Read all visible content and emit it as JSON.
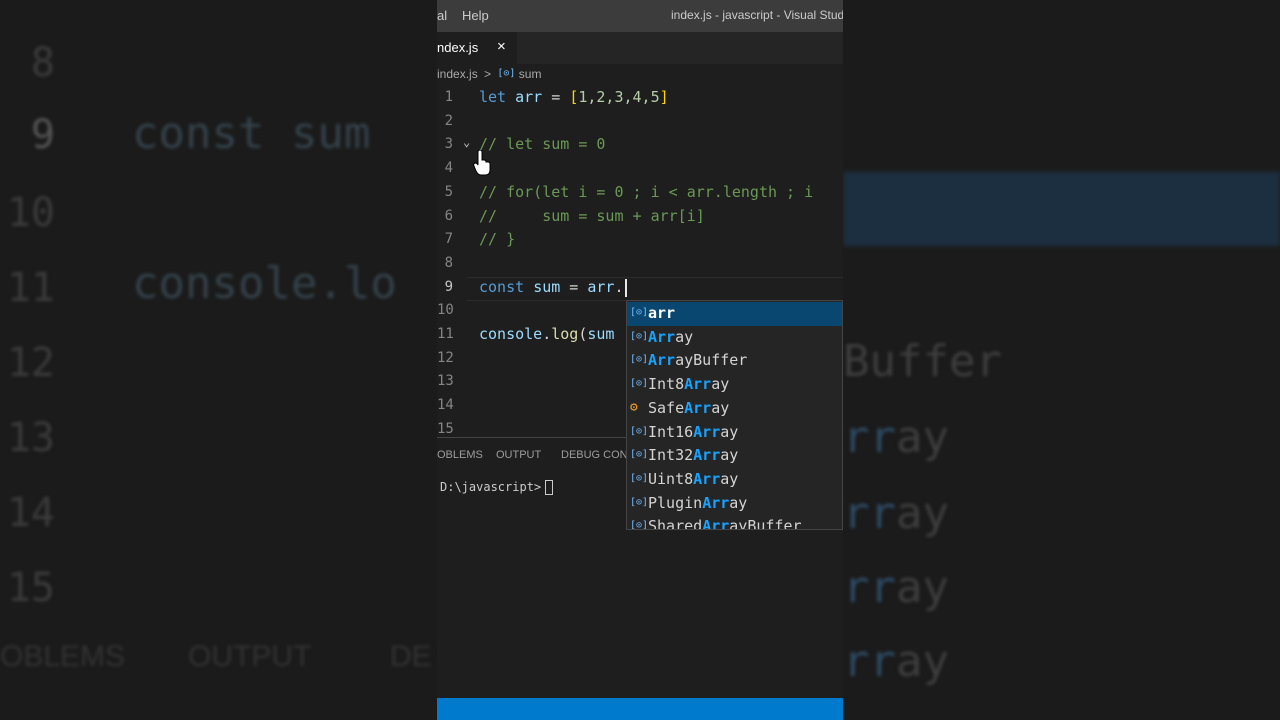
{
  "background": {
    "line_numbers": [
      "8",
      "9",
      "10",
      "11",
      "12",
      "13",
      "14",
      "15"
    ],
    "code": [
      "const sum",
      "console.lo"
    ],
    "suggest_words": [
      {
        "pre": "",
        "match": "",
        "post": "Buffer"
      },
      {
        "pre": "",
        "match": "rr",
        "post": "ay"
      },
      {
        "pre": "",
        "match": "rr",
        "post": "ay"
      },
      {
        "pre": "",
        "match": "rr",
        "post": "ay"
      },
      {
        "pre": "",
        "match": "rr",
        "post": "ay"
      }
    ],
    "panel": [
      "OBLEMS",
      "OUTPUT",
      "DE"
    ]
  },
  "titlebar": {
    "menu": [
      "al",
      "Help"
    ],
    "title": "index.js - javascript - Visual Studi"
  },
  "tab": {
    "name": "ndex.js",
    "close": "×"
  },
  "breadcrumb": {
    "file": "index.js",
    "sep": ">",
    "symbol_icon": "[⊙]",
    "symbol": "sum"
  },
  "code": {
    "lines": [
      {
        "n": "1"
      },
      {
        "n": "2"
      },
      {
        "n": "3"
      },
      {
        "n": "4"
      },
      {
        "n": "5"
      },
      {
        "n": "6"
      },
      {
        "n": "7"
      },
      {
        "n": "8"
      },
      {
        "n": "9"
      },
      {
        "n": "10"
      },
      {
        "n": "11"
      },
      {
        "n": "12"
      },
      {
        "n": "13"
      },
      {
        "n": "14"
      },
      {
        "n": "15"
      }
    ],
    "l1": {
      "kw": "let",
      "var": "arr",
      "eq": " = ",
      "open": "[",
      "nums": "1,2,3,4,5",
      "close": "]"
    },
    "l3": "// let sum = 0",
    "l5": "// for(let i = 0 ; i < arr.length ; i",
    "l6": "//     sum = sum + arr[i]",
    "l7": "// }",
    "l9": {
      "kw": "const",
      "var": "sum",
      "eq": " = ",
      "obj": "arr",
      "dot": "."
    },
    "l11": {
      "obj": "console",
      "dot": ".",
      "fn": "log",
      "open": "(",
      "arg": "sum"
    },
    "fold_icon": "⌄"
  },
  "panel": {
    "tabs": [
      "OBLEMS",
      "OUTPUT",
      "DEBUG CONS"
    ],
    "terminal_prompt": "D:\\javascript>"
  },
  "suggestions": {
    "items": [
      {
        "icon": "[⊙]",
        "kind": "variable",
        "pre": "",
        "match": "arr",
        "post": "",
        "selected": true
      },
      {
        "icon": "[⊙]",
        "kind": "variable",
        "pre": "",
        "match": "Arr",
        "post": "ay",
        "selected": false
      },
      {
        "icon": "[⊙]",
        "kind": "variable",
        "pre": "",
        "match": "Arr",
        "post": "ayBuffer",
        "selected": false
      },
      {
        "icon": "[⊙]",
        "kind": "variable",
        "pre": "Int8",
        "match": "Arr",
        "post": "ay",
        "selected": false
      },
      {
        "icon": "⚙",
        "kind": "class",
        "pre": "Safe",
        "match": "Arr",
        "post": "ay",
        "selected": false
      },
      {
        "icon": "[⊙]",
        "kind": "variable",
        "pre": "Int16",
        "match": "Arr",
        "post": "ay",
        "selected": false
      },
      {
        "icon": "[⊙]",
        "kind": "variable",
        "pre": "Int32",
        "match": "Arr",
        "post": "ay",
        "selected": false
      },
      {
        "icon": "[⊙]",
        "kind": "variable",
        "pre": "Uint8",
        "match": "Arr",
        "post": "ay",
        "selected": false
      },
      {
        "icon": "[⊙]",
        "kind": "variable",
        "pre": "Plugin",
        "match": "Arr",
        "post": "ay",
        "selected": false
      },
      {
        "icon": "[⊙]",
        "kind": "variable",
        "pre": "Shared",
        "match": "Arr",
        "post": "ayBuffer",
        "selected": false
      }
    ]
  },
  "colors": {
    "accent": "#007acc",
    "selection": "#094771",
    "match_highlight": "#18a3ff"
  }
}
